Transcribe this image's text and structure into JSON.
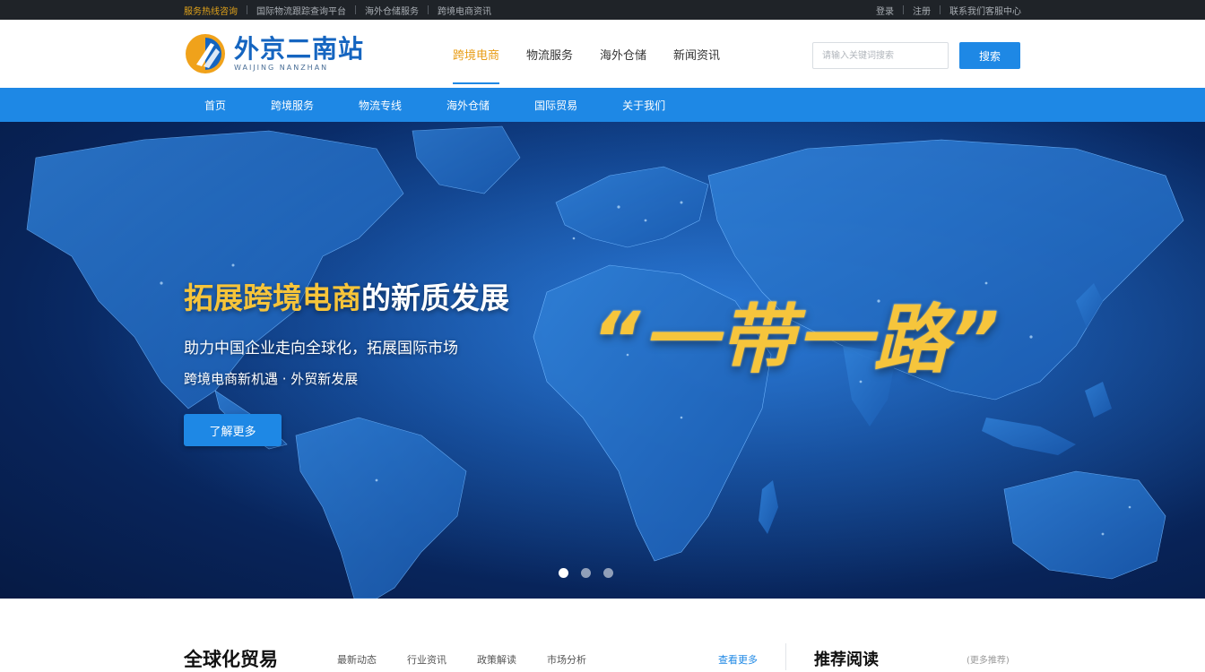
{
  "topbar": {
    "left_items": [
      "服务热线咨询",
      "国际物流跟踪查询平台",
      "海外仓储服务",
      "跨境电商资讯"
    ],
    "right_items": [
      "登录",
      "注册",
      "联系我们客服中心"
    ]
  },
  "header": {
    "logo_cn": "外京二南站",
    "logo_en": "WAIJING NANZHAN",
    "nav": [
      "跨境电商",
      "物流服务",
      "海外仓储",
      "新闻资讯"
    ],
    "search_placeholder": "请输入关键词搜索",
    "search_button": "搜索"
  },
  "subnav": [
    "首页",
    "跨境服务",
    "物流专线",
    "海外仓储",
    "国际贸易",
    "关于我们"
  ],
  "hero": {
    "title_highlight": "拓展跨境电商",
    "title_rest": "的新质发展",
    "line1": "助力中国企业走向全球化，拓展国际市场",
    "line2": "跨境电商新机遇 · 外贸新发展",
    "button": "了解更多",
    "slogan": "“一带一路”",
    "slides": 3,
    "active_slide": 1
  },
  "section": {
    "title": "全球化贸易",
    "tabs": [
      "最新动态",
      "行业资讯",
      "政策解读",
      "市场分析"
    ],
    "more": "查看更多",
    "side_title": "推荐阅读",
    "side_more": "(更多推荐)"
  },
  "colors": {
    "brand_blue": "#1e88e5",
    "accent_gold": "#f6c43a",
    "topbar_bg": "#1f2328"
  }
}
